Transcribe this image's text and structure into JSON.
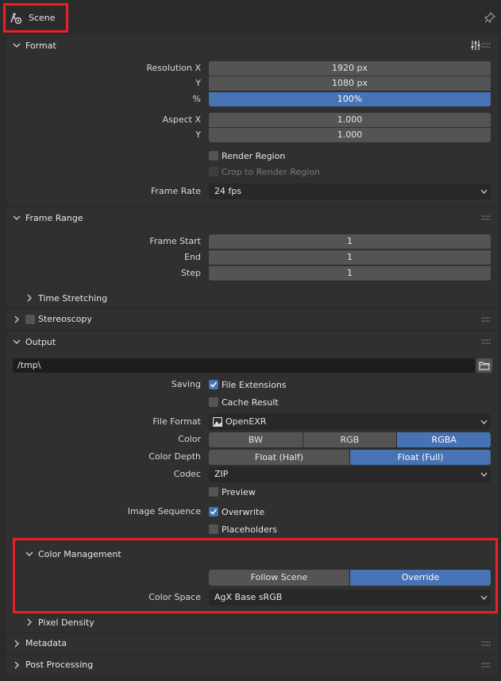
{
  "header": {
    "scene_label": "Scene"
  },
  "format": {
    "title": "Format",
    "resolution_x_label": "Resolution X",
    "resolution_x": "1920 px",
    "resolution_y_label": "Y",
    "resolution_y": "1080 px",
    "percent_label": "%",
    "percent": "100%",
    "percent_value": 1.0,
    "aspect_x_label": "Aspect X",
    "aspect_x": "1.000",
    "aspect_y_label": "Y",
    "aspect_y": "1.000",
    "render_region_label": "Render Region",
    "render_region_checked": false,
    "crop_label": "Crop to Render Region",
    "crop_checked": false,
    "frame_rate_label": "Frame Rate",
    "frame_rate": "24 fps"
  },
  "frame_range": {
    "title": "Frame Range",
    "start_label": "Frame Start",
    "start": "1",
    "end_label": "End",
    "end": "1",
    "step_label": "Step",
    "step": "1",
    "time_stretching": "Time Stretching"
  },
  "stereoscopy": {
    "title": "Stereoscopy",
    "checked": false
  },
  "output": {
    "title": "Output",
    "path": "/tmp\\",
    "saving_label": "Saving",
    "file_extensions_label": "File Extensions",
    "file_extensions_checked": true,
    "cache_result_label": "Cache Result",
    "cache_result_checked": false,
    "file_format_label": "File Format",
    "file_format": "OpenEXR",
    "color_label": "Color",
    "color_options": [
      "BW",
      "RGB",
      "RGBA"
    ],
    "color_selected": "RGBA",
    "color_depth_label": "Color Depth",
    "color_depth_options": [
      "Float (Half)",
      "Float (Full)"
    ],
    "color_depth_selected": "Float (Full)",
    "codec_label": "Codec",
    "codec": "ZIP",
    "preview_label": "Preview",
    "preview_checked": false,
    "image_sequence_label": "Image Sequence",
    "overwrite_label": "Overwrite",
    "overwrite_checked": true,
    "placeholders_label": "Placeholders",
    "placeholders_checked": false
  },
  "color_management": {
    "title": "Color Management",
    "options": [
      "Follow Scene",
      "Override"
    ],
    "selected": "Override",
    "color_space_label": "Color Space",
    "color_space": "AgX Base sRGB"
  },
  "pixel_density": {
    "title": "Pixel Density"
  },
  "metadata": {
    "title": "Metadata"
  },
  "post_processing": {
    "title": "Post Processing"
  },
  "colors": {
    "accent": "#4772b3",
    "highlight": "#e8202a",
    "panel": "#303030",
    "field": "#545454"
  }
}
